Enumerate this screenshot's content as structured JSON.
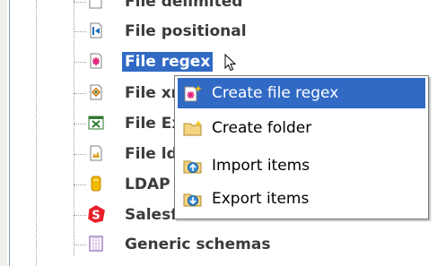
{
  "tree": {
    "items": [
      {
        "label": "File delimited",
        "icon": "file-delimited-icon"
      },
      {
        "label": "File positional",
        "icon": "file-positional-icon"
      },
      {
        "label": "File regex",
        "icon": "file-regex-icon"
      },
      {
        "label": "File xml",
        "icon": "file-xml-icon"
      },
      {
        "label": "File Excel",
        "icon": "file-excel-icon"
      },
      {
        "label": "File ldif",
        "icon": "file-ldif-icon"
      },
      {
        "label": "LDAP",
        "icon": "ldap-icon"
      },
      {
        "label": "Salesforce",
        "icon": "salesforce-icon"
      },
      {
        "label": "Generic schemas",
        "icon": "generic-schemas-icon"
      }
    ]
  },
  "context_menu": {
    "items": [
      {
        "label": "Create file regex",
        "icon": "create-file-regex-icon"
      },
      {
        "label": "Create folder",
        "icon": "create-folder-icon"
      },
      {
        "label": "Import items",
        "icon": "import-items-icon"
      },
      {
        "label": "Export items",
        "icon": "export-items-icon"
      }
    ]
  },
  "colors": {
    "selection": "#316ac5",
    "label_text": "#3b3b3b"
  }
}
